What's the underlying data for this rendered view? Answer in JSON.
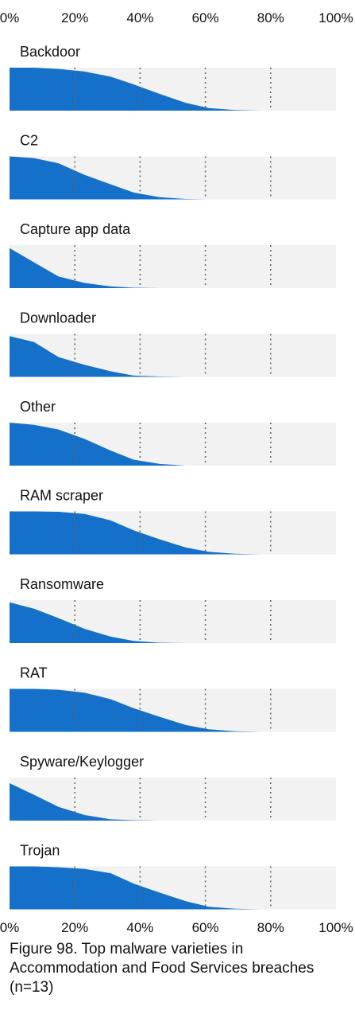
{
  "chart_data": {
    "type": "area",
    "x_axis": {
      "ticks": [
        0,
        20,
        40,
        60,
        80,
        100
      ],
      "tick_labels": [
        "0%",
        "20%",
        "40%",
        "60%",
        "80%",
        "100%"
      ],
      "range": [
        0,
        100
      ],
      "position": "top-and-bottom"
    },
    "grid": "dotted-vertical",
    "x": [
      0,
      7.5,
      15,
      23,
      31,
      38,
      46,
      54,
      61,
      69,
      77,
      83
    ],
    "series": [
      {
        "name": "Backdoor",
        "values": [
          1.0,
          1.0,
          0.97,
          0.91,
          0.79,
          0.61,
          0.39,
          0.18,
          0.06,
          0.015,
          0.0,
          0.0
        ]
      },
      {
        "name": "C2",
        "values": [
          1.0,
          0.96,
          0.84,
          0.57,
          0.35,
          0.16,
          0.05,
          0.01,
          0.0,
          0.0,
          0.0,
          0.0
        ]
      },
      {
        "name": "Capture app data",
        "values": [
          0.93,
          0.6,
          0.27,
          0.12,
          0.04,
          0.01,
          0.0,
          0.0,
          0.0,
          0.0,
          0.0,
          0.0
        ]
      },
      {
        "name": "Downloader",
        "values": [
          0.95,
          0.81,
          0.46,
          0.28,
          0.13,
          0.03,
          0.01,
          0.0,
          0.0,
          0.0,
          0.0,
          0.0
        ]
      },
      {
        "name": "Other",
        "values": [
          1.0,
          0.95,
          0.84,
          0.62,
          0.35,
          0.14,
          0.04,
          0.0,
          0.0,
          0.0,
          0.0,
          0.0
        ]
      },
      {
        "name": "RAM scraper",
        "values": [
          1.0,
          1.0,
          0.99,
          0.94,
          0.79,
          0.56,
          0.35,
          0.16,
          0.06,
          0.015,
          0.0,
          0.0
        ]
      },
      {
        "name": "Ransomware",
        "values": [
          0.95,
          0.8,
          0.58,
          0.33,
          0.15,
          0.05,
          0.01,
          0.0,
          0.0,
          0.0,
          0.0,
          0.0
        ]
      },
      {
        "name": "RAT",
        "values": [
          1.0,
          1.0,
          0.98,
          0.91,
          0.76,
          0.55,
          0.35,
          0.16,
          0.06,
          0.015,
          0.0,
          0.0
        ]
      },
      {
        "name": "Spyware/Keylogger",
        "values": [
          0.87,
          0.6,
          0.32,
          0.13,
          0.03,
          0.01,
          0.0,
          0.0,
          0.0,
          0.0,
          0.0,
          0.0
        ]
      },
      {
        "name": "Trojan",
        "values": [
          1.0,
          1.0,
          0.98,
          0.94,
          0.84,
          0.6,
          0.39,
          0.19,
          0.06,
          0.015,
          0.0,
          0.0
        ]
      }
    ],
    "colors": {
      "area_fill": "#1570c9",
      "panel_background": "#f2f2f2",
      "grid_line": "#666666",
      "text": "#111111"
    },
    "caption": "Figure 98. Top malware varieties in Accommodation and Food Services breaches (n=13)"
  }
}
